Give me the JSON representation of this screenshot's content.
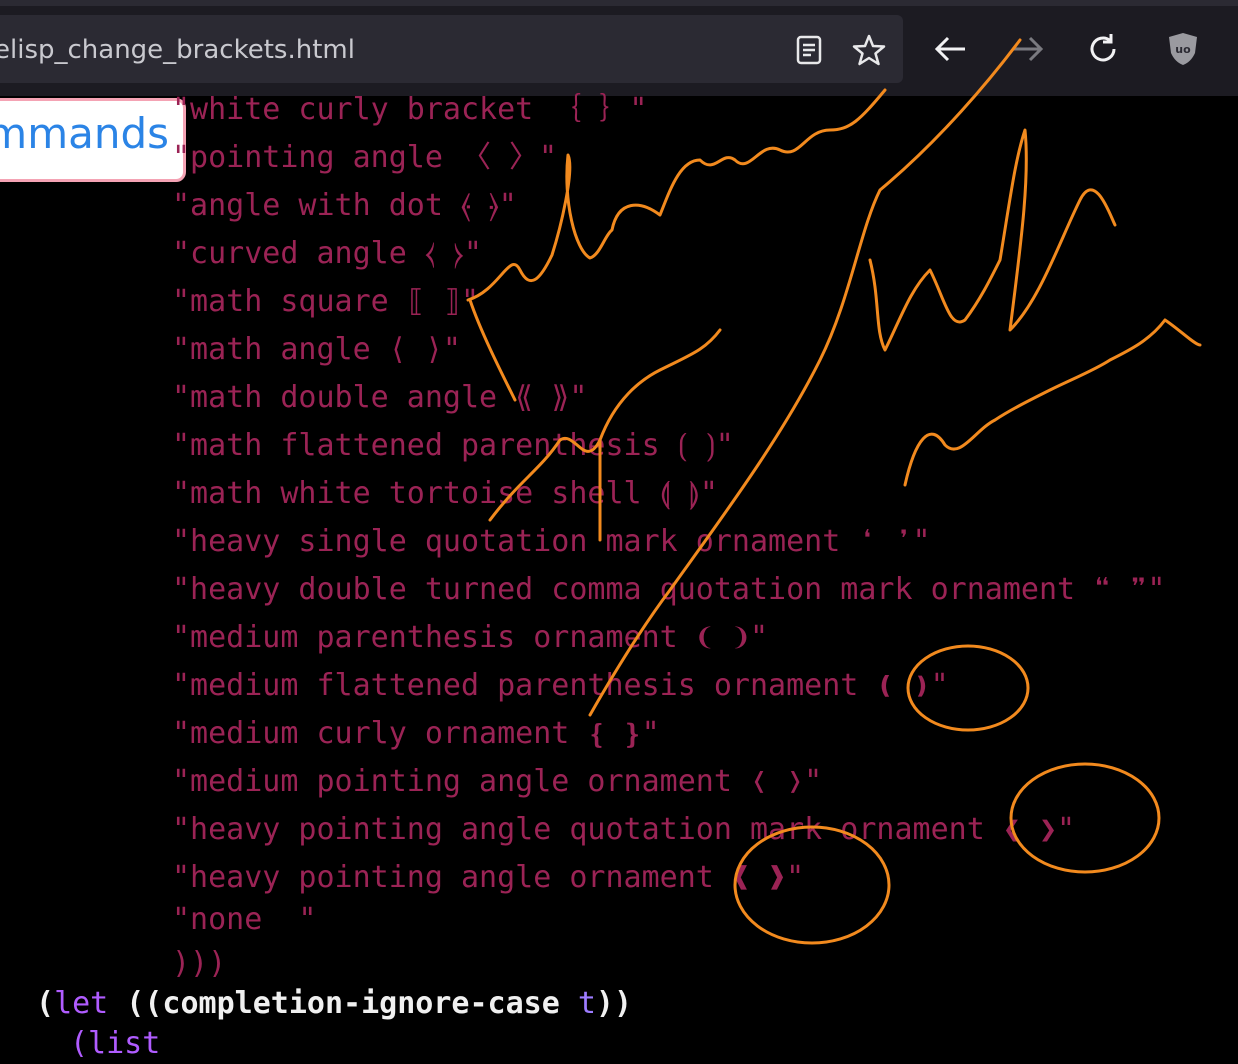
{
  "browser": {
    "url": "elisp_change_brackets.html",
    "icons": [
      "reader-view-icon",
      "bookmark-star-icon",
      "back-arrow-icon",
      "forward-arrow-icon",
      "reload-icon",
      "ublock-shield-icon"
    ]
  },
  "page": {
    "commands_button": "ommands",
    "code_lines": [
      "\"white curly bracket ｛ ｝\"",
      "\"pointing angle 〈 〉\"",
      "\"angle with dot ⦑ ⦒\"",
      "\"curved angle ⧼ ⧽\"",
      "\"math square ⟦ ⟧\"",
      "\"math angle ⟨ ⟩\"",
      "\"math double angle ⟪ ⟫\"",
      "\"math flattened parenthesis ⟮ ⟯\"",
      "\"math white tortoise shell ⟬ ⟭\"",
      "\"heavy single quotation mark ornament ❛ ❜\"",
      "\"heavy double turned comma quotation mark ornament ❝ ❞\"",
      "\"medium parenthesis ornament ❨ ❩\"",
      "\"medium flattened parenthesis ornament ❪ ❫\"",
      "\"medium curly ornament ❴ ❵\"",
      "\"medium pointing angle ornament ❬ ❭\"",
      "\"heavy pointing angle quotation mark ornament ❮ ❯\"",
      "\"heavy pointing angle ornament ❰ ❱\"",
      "\"none  \"",
      ")))"
    ],
    "let_line": {
      "open": "(",
      "kw": "let",
      "mid": " ((completion-ignore-case ",
      "t": "t",
      "close": "))"
    },
    "next_line": "(list"
  },
  "annotations": {
    "colors": {
      "ink": "#f28a1e"
    },
    "handwriting": [
      "find-commas",
      "support",
      "maybe",
      "remove"
    ]
  }
}
